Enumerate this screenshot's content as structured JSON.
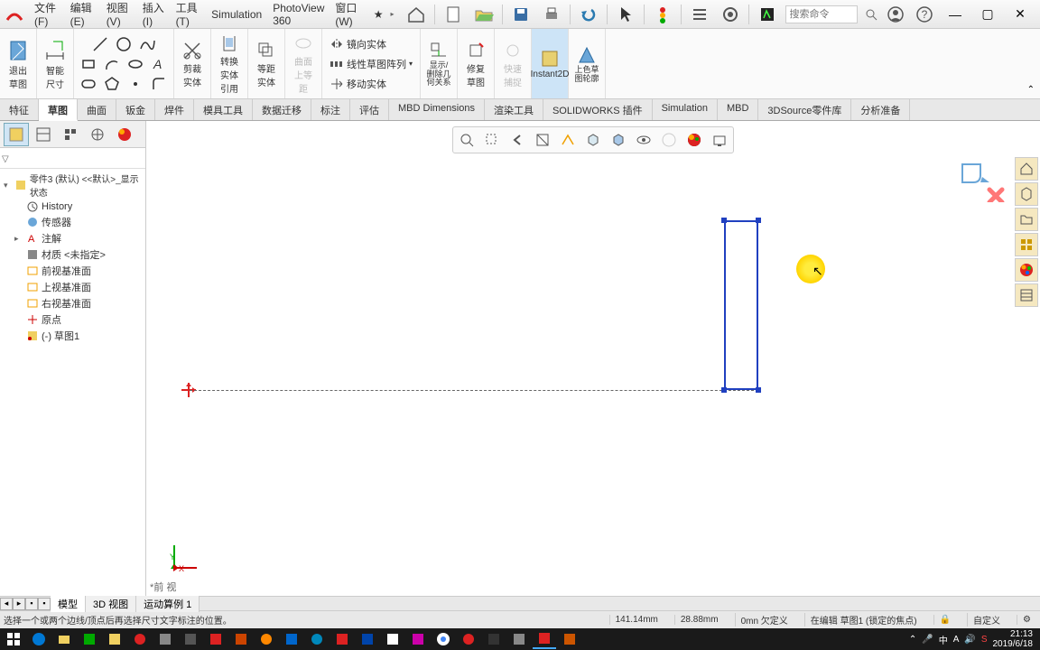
{
  "menu": {
    "file": "文件(F)",
    "edit": "编辑(E)",
    "view": "视图(V)",
    "insert": "插入(I)",
    "tools": "工具(T)",
    "simulation": "Simulation",
    "photoview": "PhotoView 360",
    "window": "窗口(W)",
    "star": "★",
    "search_placeholder": "搜索命令"
  },
  "ribbon": {
    "exit_sketch": "退出草图",
    "smart_dim": "智能尺寸",
    "trim": "剪裁实体",
    "convert": "转换实体引用",
    "offset": "等距实体",
    "surface_offset": "曲面上等距",
    "mirror": "镜向实体",
    "linear_pattern": "线性草图阵列",
    "move": "移动实体",
    "display_delete": "显示/删除几何关系",
    "repair": "修复草图",
    "quick_snap": "快速捕捉",
    "instant2d": "Instant2D",
    "shaded": "上色草图轮廓"
  },
  "tabs": {
    "features": "特征",
    "sketch": "草图",
    "surface": "曲面",
    "sheetmetal": "钣金",
    "weldment": "焊件",
    "moldtools": "模具工具",
    "datamigration": "数据迁移",
    "markup": "标注",
    "evaluate": "评估",
    "mbd": "MBD Dimensions",
    "render": "渲染工具",
    "addins": "SOLIDWORKS 插件",
    "simulation": "Simulation",
    "mbd2": "MBD",
    "library3d": "3DSource零件库",
    "analysis": "分析准备"
  },
  "tree": {
    "root": "零件3 (默认) <<默认>_显示状态",
    "history": "History",
    "sensors": "传感器",
    "annotations": "注解",
    "material": "材质 <未指定>",
    "front_plane": "前视基准面",
    "top_plane": "上视基准面",
    "right_plane": "右视基准面",
    "origin": "原点",
    "sketch1": "(-) 草图1"
  },
  "canvas": {
    "view_label": "*前 视",
    "y_label": "Y",
    "x_label": "X"
  },
  "bottom_tabs": {
    "model": "模型",
    "view3d": "3D 视图",
    "motion": "运动算例 1"
  },
  "status": {
    "hint": "选择一个或两个边线/顶点后再选择尺寸文字标注的位置。",
    "x": "141.14mm",
    "y": "28.88mm",
    "def": "0mn 欠定义",
    "editing": "在编辑 草图1 (锁定的焦点)",
    "custom": "自定义"
  },
  "taskbar": {
    "time": "21:13",
    "date": "2019/6/18"
  }
}
